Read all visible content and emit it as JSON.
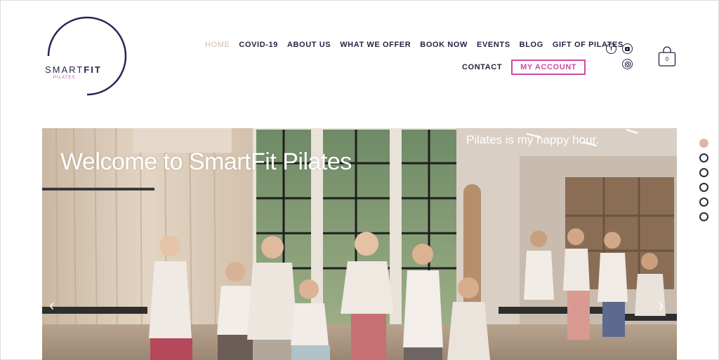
{
  "logo": {
    "name": "SMART",
    "name_bold": "FIT",
    "sub": "PILATES"
  },
  "nav": {
    "row1": [
      "HOME",
      "COVID-19",
      "ABOUT US",
      "WHAT WE OFFER",
      "BOOK NOW",
      "EVENTS",
      "BLOG",
      "GIFT OF PILATES"
    ],
    "contact": "CONTACT",
    "account": "MY ACCOUNT"
  },
  "social": {
    "icons": [
      "facebook-icon",
      "youtube-icon",
      "instagram-icon"
    ]
  },
  "cart": {
    "count": "0"
  },
  "hero": {
    "title": "Welcome to SmartFit Pilates",
    "tagline": "Pilates is my happy hour.",
    "prev": "‹",
    "next": "›"
  },
  "slider": {
    "count": 6,
    "active": 0
  },
  "colors": {
    "navy": "#1f2340",
    "accent_pink": "#d04aa0",
    "nav_active": "#d8b8a0",
    "dot_active": "#ddb7a5"
  }
}
